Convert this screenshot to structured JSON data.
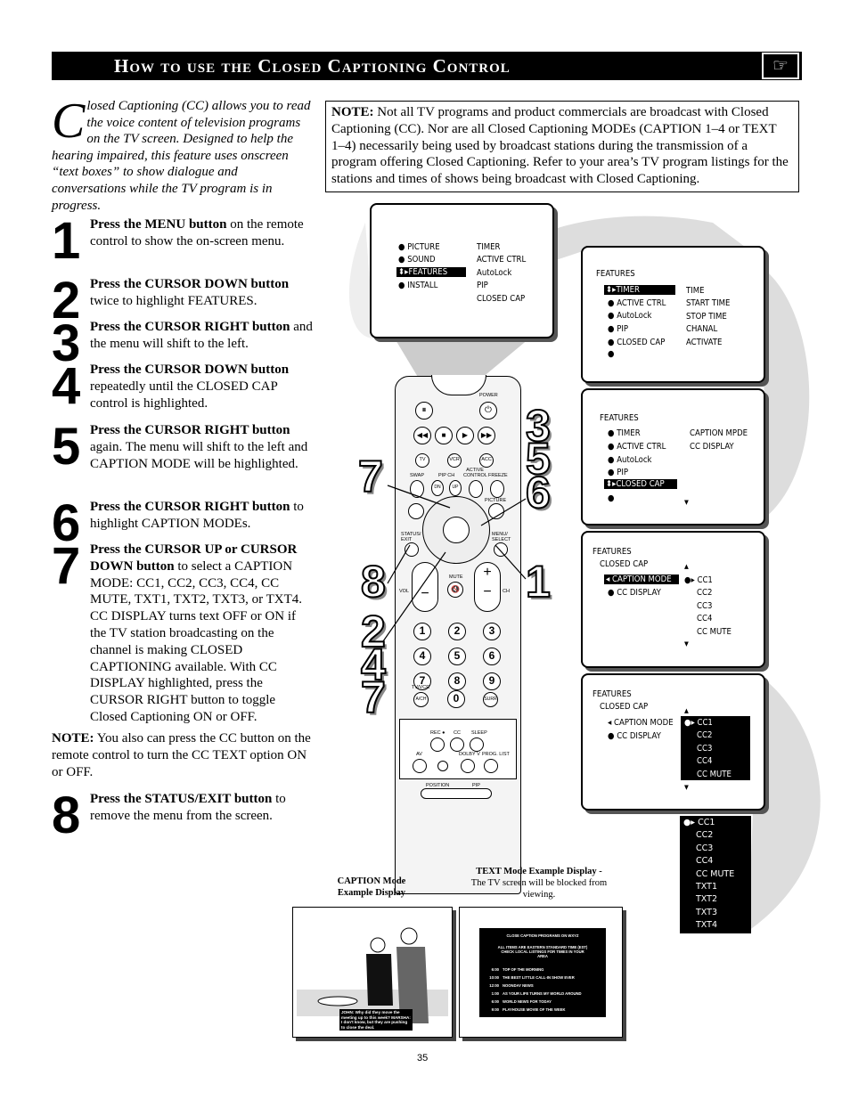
{
  "header": {
    "title": "How to use the Closed Captioning Control",
    "icon": "pointing-hand-icon"
  },
  "intro": {
    "dropcap": "C",
    "text": "losed Captioning (CC) allows you to read the voice content of television programs on the TV screen.  Designed to help the hearing impaired, this feature uses onscreen “text boxes” to show dialogue and conversations while the TV program is in progress."
  },
  "steps": [
    {
      "num": "1",
      "bold": "Press the MENU button",
      "rest": " on the remote control to show the on-screen menu."
    },
    {
      "num": "2",
      "bold": "Press the CURSOR DOWN button",
      "rest": " twice to highlight FEATURES."
    },
    {
      "num": "3",
      "bold": "Press the CURSOR RIGHT button",
      "rest": " and the menu will shift to the left."
    },
    {
      "num": "4",
      "bold": "Press the CURSOR DOWN button",
      "rest": " repeatedly until the CLOSED CAP control is highlighted."
    },
    {
      "num": "5",
      "bold": "Press the CURSOR RIGHT button",
      "rest": " again. The menu will shift to the left and CAPTION MODE will be highlighted."
    },
    {
      "num": "6",
      "bold": "Press the CURSOR RIGHT button",
      "rest": " to highlight CAPTION MODEs."
    },
    {
      "num": "7",
      "bold": "Press the CURSOR UP or CURSOR DOWN button",
      "rest": " to select a CAPTION MODE:  CC1, CC2, CC3, CC4, CC MUTE, TXT1, TXT2, TXT3, or TXT4. CC DISPLAY turns text OFF or ON if the TV station broadcasting on the channel is making CLOSED CAPTIONING available. With CC DISPLAY highlighted, press the CURSOR RIGHT button to toggle Closed Captioning ON or OFF."
    },
    {
      "num": "8",
      "bold": "Press the STATUS/EXIT button",
      "rest": " to remove the menu from the screen."
    }
  ],
  "note_left": {
    "bold": "NOTE:",
    "rest": " You also can press the CC button on the remote control to turn the CC TEXT option ON or OFF."
  },
  "note_box": {
    "bold": "NOTE:",
    "rest": "  Not all TV programs and product commercials are broadcast with Closed Captioning (CC).  Nor are all Closed Captioning  MODEs (CAPTION 1–4 or TEXT 1–4) necessarily being used by broadcast stations during the transmission of a program offering Closed Captioning.  Refer to your area’s TV program listings for the stations and times of shows being broadcast with Closed Captioning."
  },
  "menus": {
    "main": {
      "left": [
        "PICTURE",
        "SOUND",
        "FEATURES",
        "INSTALL"
      ],
      "right": [
        "TIMER",
        "ACTIVE CTRL",
        "AutoLock",
        "PIP",
        "CLOSED CAP"
      ]
    },
    "features1": {
      "title": "FEATURES",
      "left": [
        "TIMER",
        "ACTIVE CTRL",
        "AutoLock",
        "PIP",
        "CLOSED CAP"
      ],
      "right": [
        "TIME",
        "START TIME",
        "STOP TIME",
        "CHANAL",
        "ACTIVATE"
      ]
    },
    "features2": {
      "title": "FEATURES",
      "left": [
        "TIMER",
        "ACTIVE CTRL",
        "AutoLock",
        "PIP",
        "CLOSED CAP"
      ],
      "right": [
        "CAPTION MPDE",
        "CC DISPLAY"
      ]
    },
    "cc1": {
      "title": "FEATURES",
      "sub": "CLOSED CAP",
      "left": [
        "CAPTION MODE",
        "CC DISPLAY"
      ],
      "right": [
        "CC1",
        "CC2",
        "CC3",
        "CC4",
        "CC MUTE"
      ]
    },
    "cc2": {
      "title": "FEATURES",
      "sub": "CLOSED CAP",
      "left": [
        "CAPTION MODE",
        "CC DISPLAY"
      ],
      "right": [
        "CC1",
        "CC2",
        "CC3",
        "CC4",
        "CC MUTE"
      ]
    },
    "fulllist": [
      "CC1",
      "CC2",
      "CC3",
      "CC4",
      "CC MUTE",
      "TXT1",
      "TXT2",
      "TXT3",
      "TXT4"
    ]
  },
  "remote": {
    "power": "POWER",
    "tv": "TV",
    "vcr": "VCR",
    "acc": "ACC",
    "swap": "SWAP",
    "pipch": "PIP CH",
    "dn": "DN",
    "up": "UP",
    "active": "ACTIVE CONTROL",
    "freeze": "FREEZE",
    "picture": "PICTURE",
    "status": "STATUS/ EXIT",
    "menu": "MENU/ SELECT",
    "mute": "MUTE",
    "vol": "VOL",
    "ch": "CH",
    "digits": [
      "1",
      "2",
      "3",
      "4",
      "5",
      "6",
      "7",
      "8",
      "9"
    ],
    "zero": "0",
    "tvvcr": "TV/VCR",
    "ach": "A/CH",
    "surr": "SURR",
    "rec": "REC ●",
    "cc": "CC",
    "sleep": "SLEEP",
    "av": "AV",
    "dolby": "DOLBY V",
    "progl": "PROG. LIST",
    "position": "POSITION",
    "pip": "PIP"
  },
  "callouts": {
    "a": "7",
    "b": "3",
    "c": "5",
    "d": "6",
    "e": "8",
    "f": "1",
    "g": "2",
    "h": "4",
    "i": "7"
  },
  "examples": {
    "caption_label": "CAPTION Mode Example Display",
    "caption_text": "JOHN: Why did they move  the meeting up to this week? MARSHA: I don't know, but they are pushing to close the deal.",
    "text_label_bold": "TEXT  Mode Example Display -",
    "text_label_rest": "The TV screen will be blocked from viewing.",
    "text_screen": {
      "title": "CLOSE CAPTION PROGRAMS ON WXYZ",
      "info": "ALL ITEMS ARE EASTERN STANDARD TIME (EST) CHECK LOCAL LISTINGS FOR TIMES IN YOUR AREA",
      "rows": [
        [
          "6:00",
          "TOP OF THE MORNING"
        ],
        [
          "10:00",
          "THE BEST LITTLE CALL-IN SHOW EVER"
        ],
        [
          "12:00",
          "NOONDAY NEWS"
        ],
        [
          "1:00",
          "AS YOUR LIFE TURNS MY WORLD AROUND"
        ],
        [
          "6:00",
          "WORLD NEWS FOR TODAY"
        ],
        [
          "9:00",
          "PLAYHOUSE MOVIE OF THE WEEK"
        ]
      ]
    }
  },
  "page_number": "35"
}
